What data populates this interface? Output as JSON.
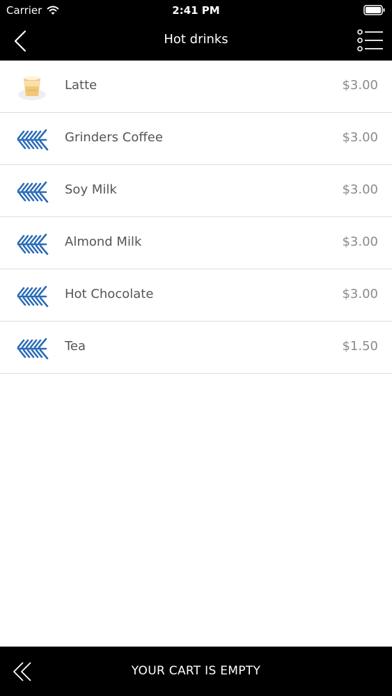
{
  "status_bar": {
    "carrier": "Carrier",
    "time": "2:41 PM"
  },
  "nav": {
    "title": "Hot drinks",
    "back_icon": "chevron-left-icon",
    "menu_icon": "list-menu-icon"
  },
  "items": [
    {
      "name": "Latte",
      "price": "$3.00",
      "icon": "latte-cup-icon"
    },
    {
      "name": "Grinders Coffee",
      "price": "$3.00",
      "icon": "brand-logo-icon"
    },
    {
      "name": "Soy Milk",
      "price": "$3.00",
      "icon": "brand-logo-icon"
    },
    {
      "name": "Almond Milk",
      "price": "$3.00",
      "icon": "brand-logo-icon"
    },
    {
      "name": "Hot Chocolate",
      "price": "$3.00",
      "icon": "brand-logo-icon"
    },
    {
      "name": "Tea",
      "price": "$1.50",
      "icon": "brand-logo-icon"
    }
  ],
  "cart": {
    "label": "YOUR CART IS EMPTY",
    "icon": "double-chevron-left-icon"
  },
  "colors": {
    "bar_background": "#000000",
    "logo_blue": "#2a6bb5",
    "text": "#555555",
    "price": "#8a8a8a"
  }
}
